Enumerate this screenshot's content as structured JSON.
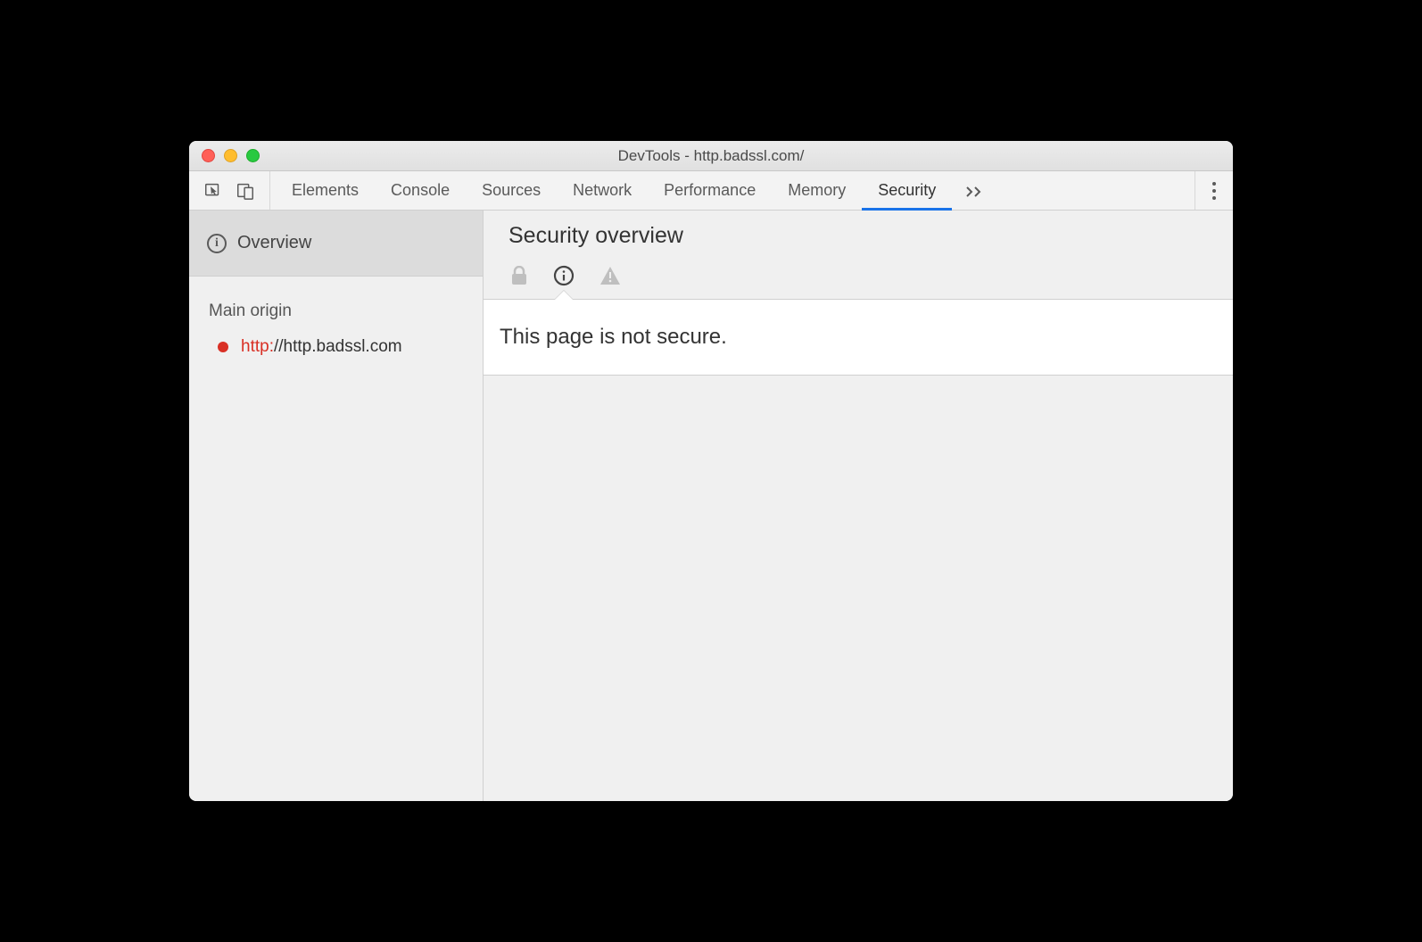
{
  "window": {
    "title": "DevTools - http.badssl.com/"
  },
  "toolbar": {
    "tabs": [
      {
        "label": "Elements",
        "active": false
      },
      {
        "label": "Console",
        "active": false
      },
      {
        "label": "Sources",
        "active": false
      },
      {
        "label": "Network",
        "active": false
      },
      {
        "label": "Performance",
        "active": false
      },
      {
        "label": "Memory",
        "active": false
      },
      {
        "label": "Security",
        "active": true
      }
    ]
  },
  "sidebar": {
    "overview_label": "Overview",
    "main_origin_label": "Main origin",
    "origin": {
      "scheme": "http:",
      "rest": "//http.badssl.com",
      "status_color": "#d93025"
    }
  },
  "main": {
    "title": "Security overview",
    "message": "This page is not secure."
  }
}
